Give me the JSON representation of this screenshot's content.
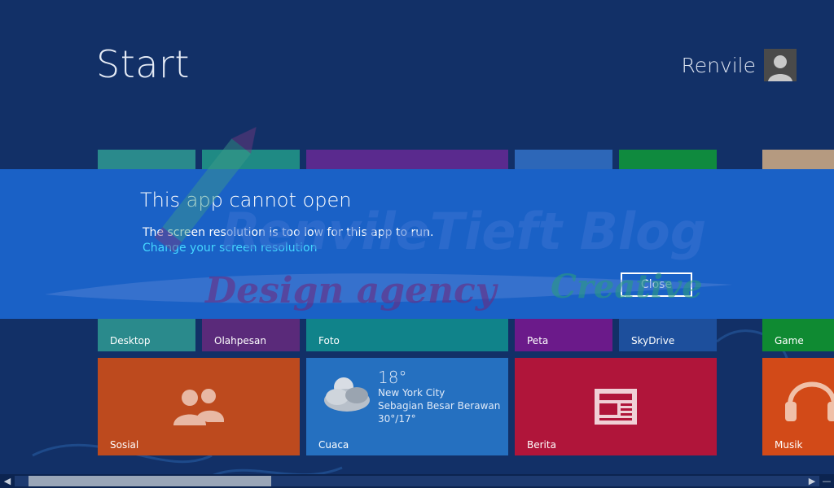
{
  "start": {
    "title": "Start"
  },
  "user": {
    "name": "Renvile"
  },
  "tiles": {
    "desktop": {
      "label": "Desktop"
    },
    "olahpesan": {
      "label": "Olahpesan"
    },
    "foto": {
      "label": "Foto"
    },
    "peta": {
      "label": "Peta"
    },
    "skydrive": {
      "label": "SkyDrive"
    },
    "game": {
      "label": "Game"
    },
    "sosial": {
      "label": "Sosial"
    },
    "cuaca": {
      "label": "Cuaca",
      "temp": "18°",
      "city": "New York City",
      "condition": "Sebagian Besar Berawan",
      "range": "30°/17°"
    },
    "berita": {
      "label": "Berita"
    },
    "musik": {
      "label": "Musik"
    }
  },
  "dialog": {
    "title": "This app cannot open",
    "message": "The screen resolution is too low for this app to run.",
    "link": "Change your screen resolution",
    "close_label": "Close"
  },
  "watermark": {
    "line1": "RenvileTieft Blog",
    "line2a": "Design agency",
    "line2b": "Creative"
  },
  "colors": {
    "background": "#123067",
    "dialog": "#1a61c6",
    "link": "#44d6ff"
  }
}
